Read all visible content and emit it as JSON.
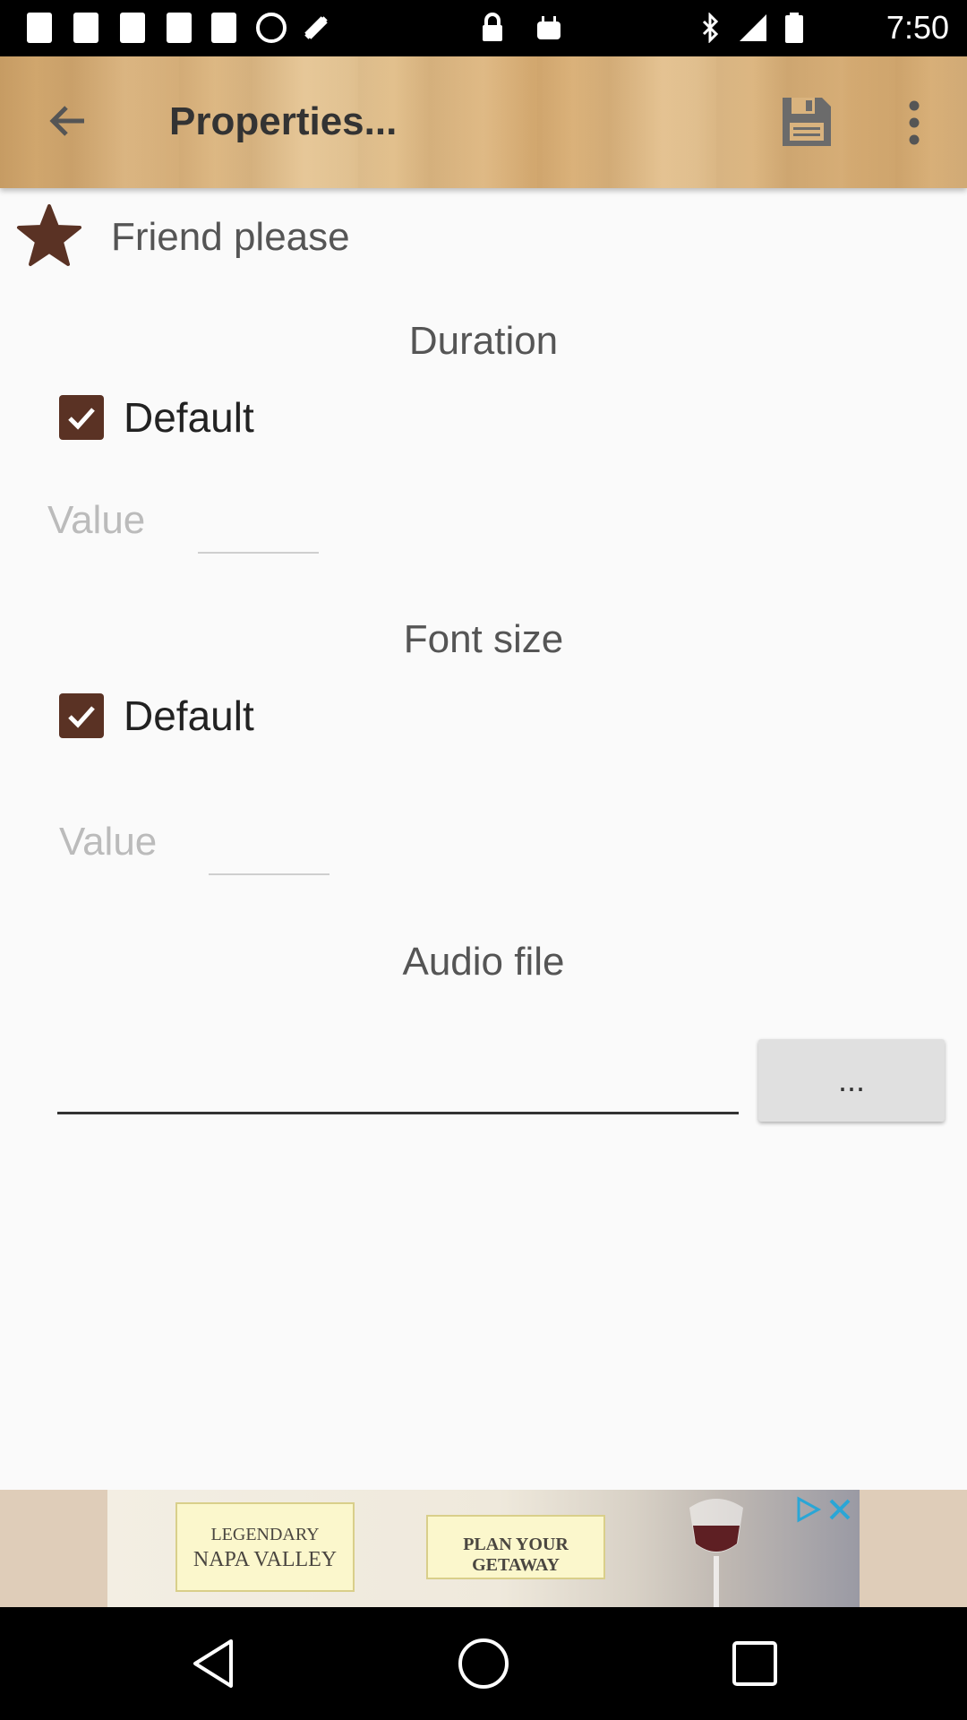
{
  "status_bar": {
    "time": "7:50"
  },
  "app_bar": {
    "title": "Properties..."
  },
  "item": {
    "name": "Friend please"
  },
  "duration": {
    "title": "Duration",
    "default_label": "Default",
    "default_checked": true,
    "value_label": "Value",
    "value": ""
  },
  "font_size": {
    "title": "Font size",
    "default_label": "Default",
    "default_checked": true,
    "value_label": "Value",
    "value": ""
  },
  "audio": {
    "title": "Audio file",
    "path": "",
    "browse_label": "..."
  },
  "ad": {
    "line1": "LEGENDARY",
    "line2": "NAPA VALLEY",
    "cta": "PLAN YOUR GETAWAY"
  },
  "colors": {
    "accent": "#5a3224",
    "star": "#5a3224"
  }
}
